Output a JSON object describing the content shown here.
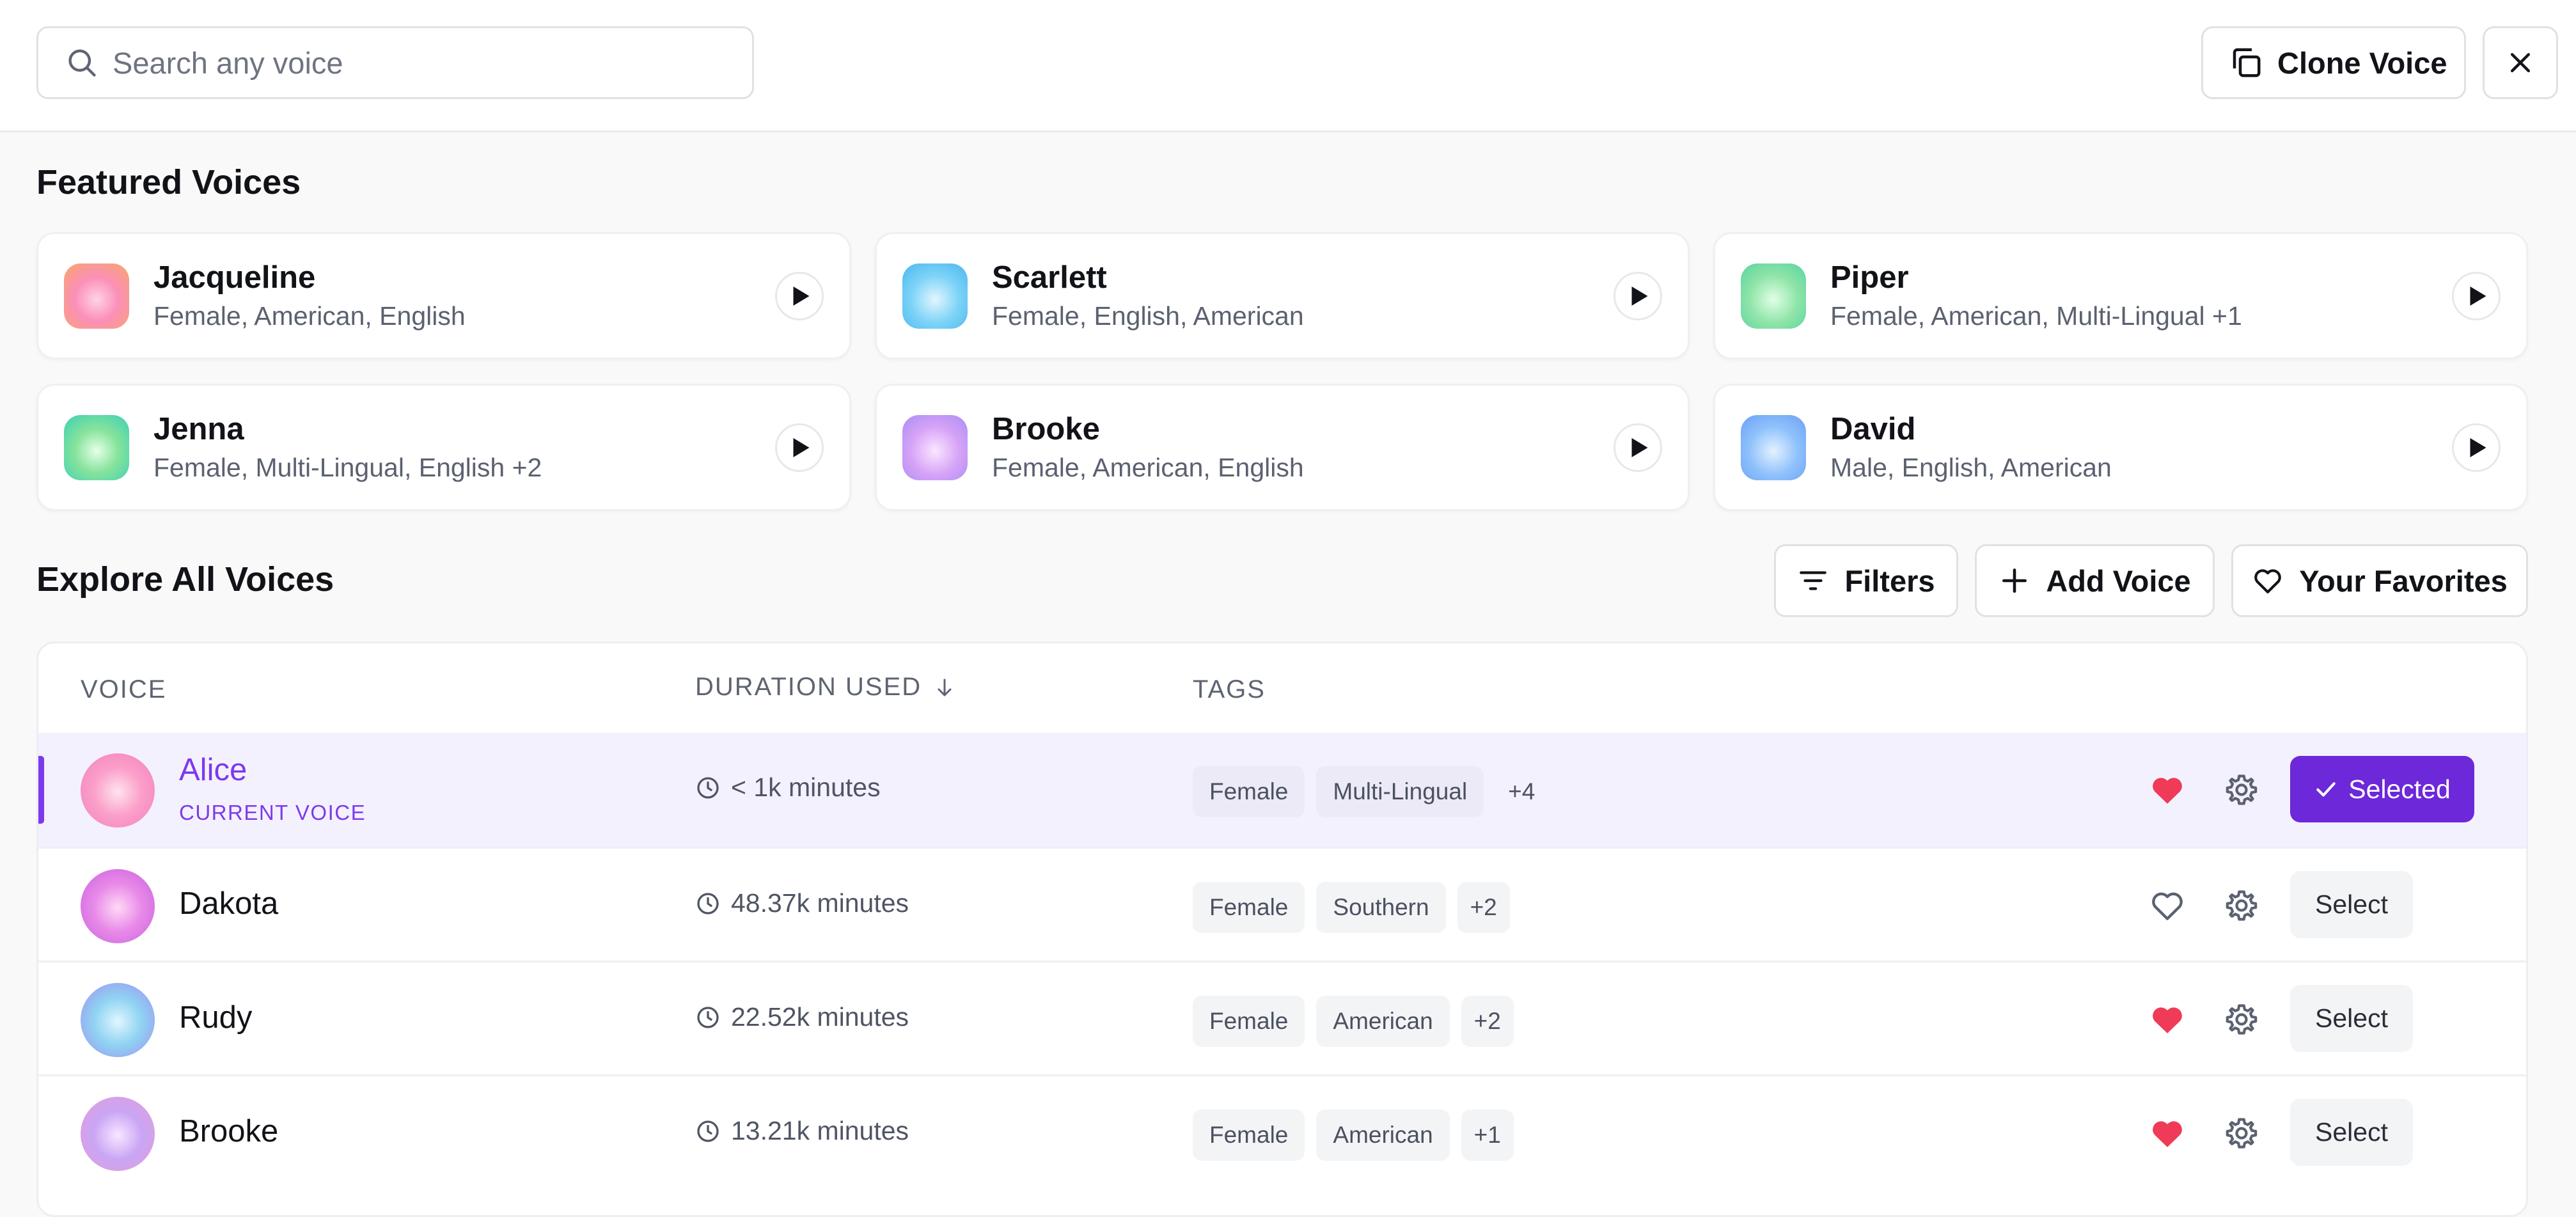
{
  "search": {
    "placeholder": "Search any voice"
  },
  "header": {
    "clone_label": "Clone Voice"
  },
  "colors": {
    "accent": "#7c3aed",
    "selected_button": "#6d28d9",
    "heart_filled": "#ef3b57"
  },
  "featured": {
    "title": "Featured Voices",
    "cards": [
      {
        "name": "Jacqueline",
        "tags": "Female, American, English",
        "avatar": "orange-pink"
      },
      {
        "name": "Scarlett",
        "tags": "Female, English, American",
        "avatar": "light-blue"
      },
      {
        "name": "Piper",
        "tags": "Female, American, Multi-Lingual +1",
        "avatar": "green"
      },
      {
        "name": "Jenna",
        "tags": "Female, Multi-Lingual, English +2",
        "avatar": "green-teal"
      },
      {
        "name": "Brooke",
        "tags": "Female, American, English",
        "avatar": "purple-pink"
      },
      {
        "name": "David",
        "tags": "Male, English, American",
        "avatar": "blue"
      }
    ]
  },
  "explore": {
    "title": "Explore All Voices",
    "filters_label": "Filters",
    "add_label": "Add Voice",
    "favorites_label": "Your Favorites"
  },
  "table": {
    "columns": {
      "voice": "VOICE",
      "duration": "DURATION USED",
      "tags": "TAGS"
    },
    "current_voice_label": "CURRENT VOICE",
    "select_label": "Select",
    "selected_label": "Selected",
    "rows": [
      {
        "name": "Alice",
        "duration": "< 1k minutes",
        "tags": [
          "Female",
          "Multi-Lingual"
        ],
        "more": "+4",
        "favorite": true,
        "current": true,
        "avatar": "pink"
      },
      {
        "name": "Dakota",
        "duration": "48.37k minutes",
        "tags": [
          "Female",
          "Southern"
        ],
        "more": "+2",
        "favorite": false,
        "current": false,
        "avatar": "magenta"
      },
      {
        "name": "Rudy",
        "duration": "22.52k minutes",
        "tags": [
          "Female",
          "American"
        ],
        "more": "+2",
        "favorite": true,
        "current": false,
        "avatar": "blue-purple"
      },
      {
        "name": "Brooke",
        "duration": "13.21k minutes",
        "tags": [
          "Female",
          "American"
        ],
        "more": "+1",
        "favorite": true,
        "current": false,
        "avatar": "lavender"
      }
    ]
  }
}
